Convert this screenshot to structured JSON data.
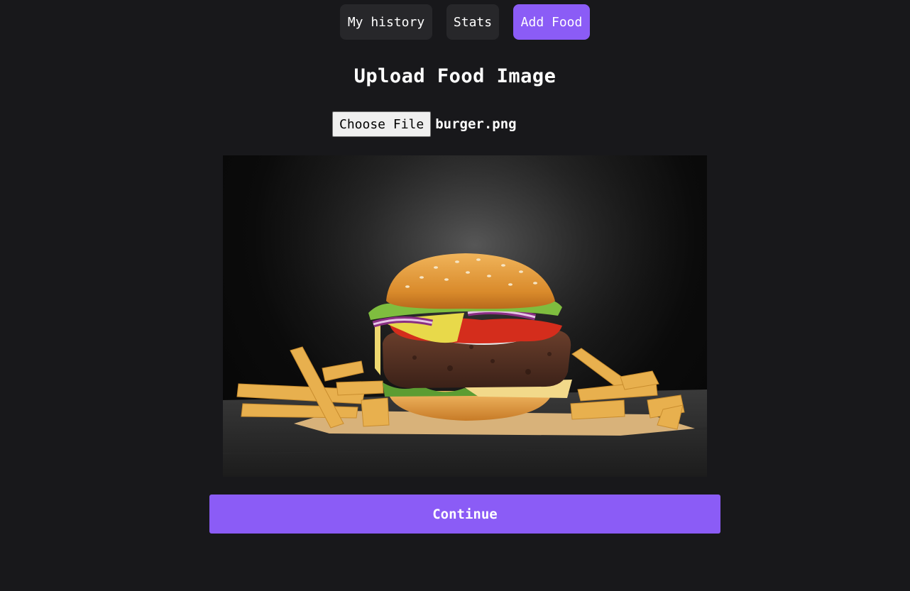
{
  "nav": {
    "items": [
      {
        "label": "My history"
      },
      {
        "label": "Stats"
      },
      {
        "label": "Add Food",
        "active": true
      }
    ]
  },
  "upload": {
    "title": "Upload Food Image",
    "choose_label": "Choose File",
    "file_name": "burger.png"
  },
  "preview": {
    "subject": "burger-with-fries-photo"
  },
  "actions": {
    "continue_label": "Continue"
  },
  "colors": {
    "background": "#18181b",
    "nav_button": "#27272a",
    "accent": "#8b5cf6"
  }
}
